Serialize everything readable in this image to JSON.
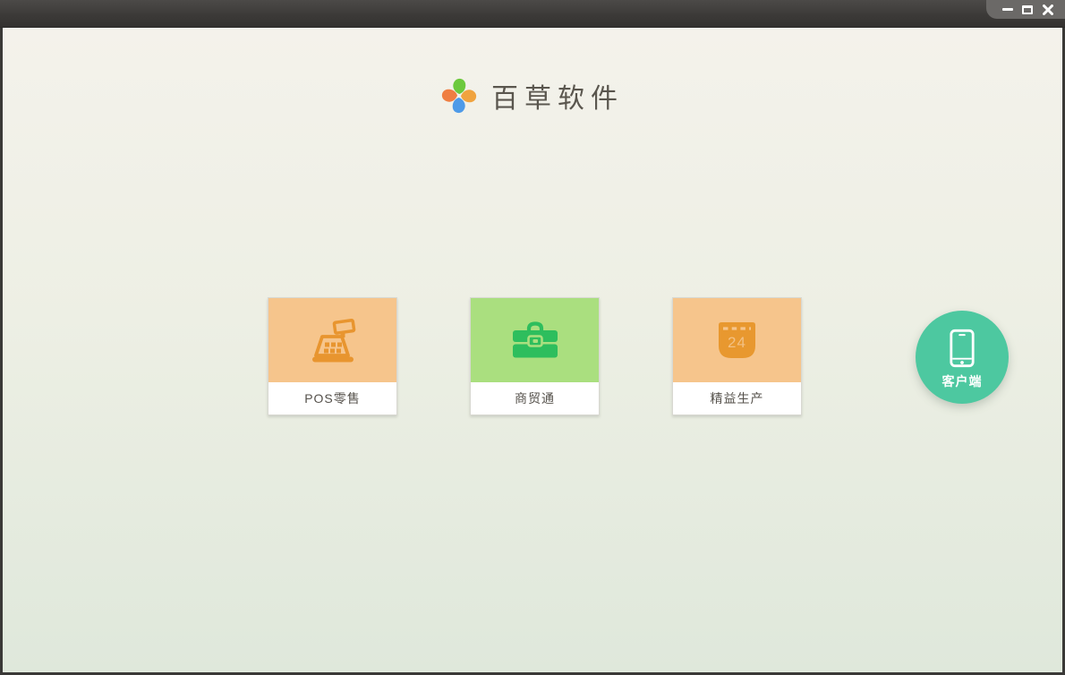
{
  "window": {
    "controls": {
      "minimize": "minimize-window",
      "maximize": "maximize-window",
      "close": "close-window"
    }
  },
  "header": {
    "app_name": "百草软件",
    "logo": "pinwheel-logo-icon",
    "logo_colors": {
      "top": "#6cc93d",
      "right": "#f0a33f",
      "bottom": "#4e9ae8",
      "left": "#ef7e42"
    }
  },
  "products": [
    {
      "label": "POS零售",
      "icon": "cash-register-icon",
      "tile_color": "#f6c58c",
      "icon_color": "#e8952f"
    },
    {
      "label": "商贸通",
      "icon": "briefcase-icon",
      "tile_color": "#aadf7f",
      "icon_color": "#2ebe5d"
    },
    {
      "label": "精益生产",
      "icon": "calendar-icon",
      "tile_color": "#f6c58c",
      "icon_color": "#e8982f",
      "calendar_day": "24"
    }
  ],
  "client_button": {
    "label": "客户端",
    "icon": "smartphone-icon",
    "color": "#4dc8a0"
  },
  "colors": {
    "title_bar": "#3c3a38",
    "controls_panel": "#6b6967",
    "frame_border": "#3a3937",
    "background_top": "#f4f2eb",
    "background_bottom": "#dfe8db",
    "card_label_text": "#55514b"
  }
}
